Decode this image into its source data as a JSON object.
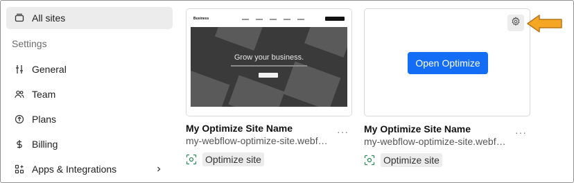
{
  "sidebar": {
    "all_sites": {
      "label": "All sites",
      "icon": "sites-icon"
    },
    "settings_heading": "Settings",
    "items": [
      {
        "label": "General",
        "icon": "sliders-icon"
      },
      {
        "label": "Team",
        "icon": "team-icon"
      },
      {
        "label": "Plans",
        "icon": "plans-icon"
      },
      {
        "label": "Billing",
        "icon": "dollar-icon"
      },
      {
        "label": "Apps & Integrations",
        "icon": "apps-icon"
      }
    ]
  },
  "cards": [
    {
      "thumbnail": {
        "logo": "Business",
        "headline": "Grow your business."
      },
      "name": "My Optimize Site Name",
      "url": "my-webflow-optimize-site.webflow.io",
      "badge": "Optimize site",
      "more_label": "···"
    },
    {
      "open_button": "Open Optimize",
      "name": "My Optimize Site Name",
      "url": "my-webflow-optimize-site.webflow.io",
      "badge": "Optimize site",
      "more_label": "···"
    }
  ],
  "colors": {
    "accent": "#146ef5",
    "annotation_arrow": "#f5a623",
    "optimize_icon": "#2e8b57"
  }
}
